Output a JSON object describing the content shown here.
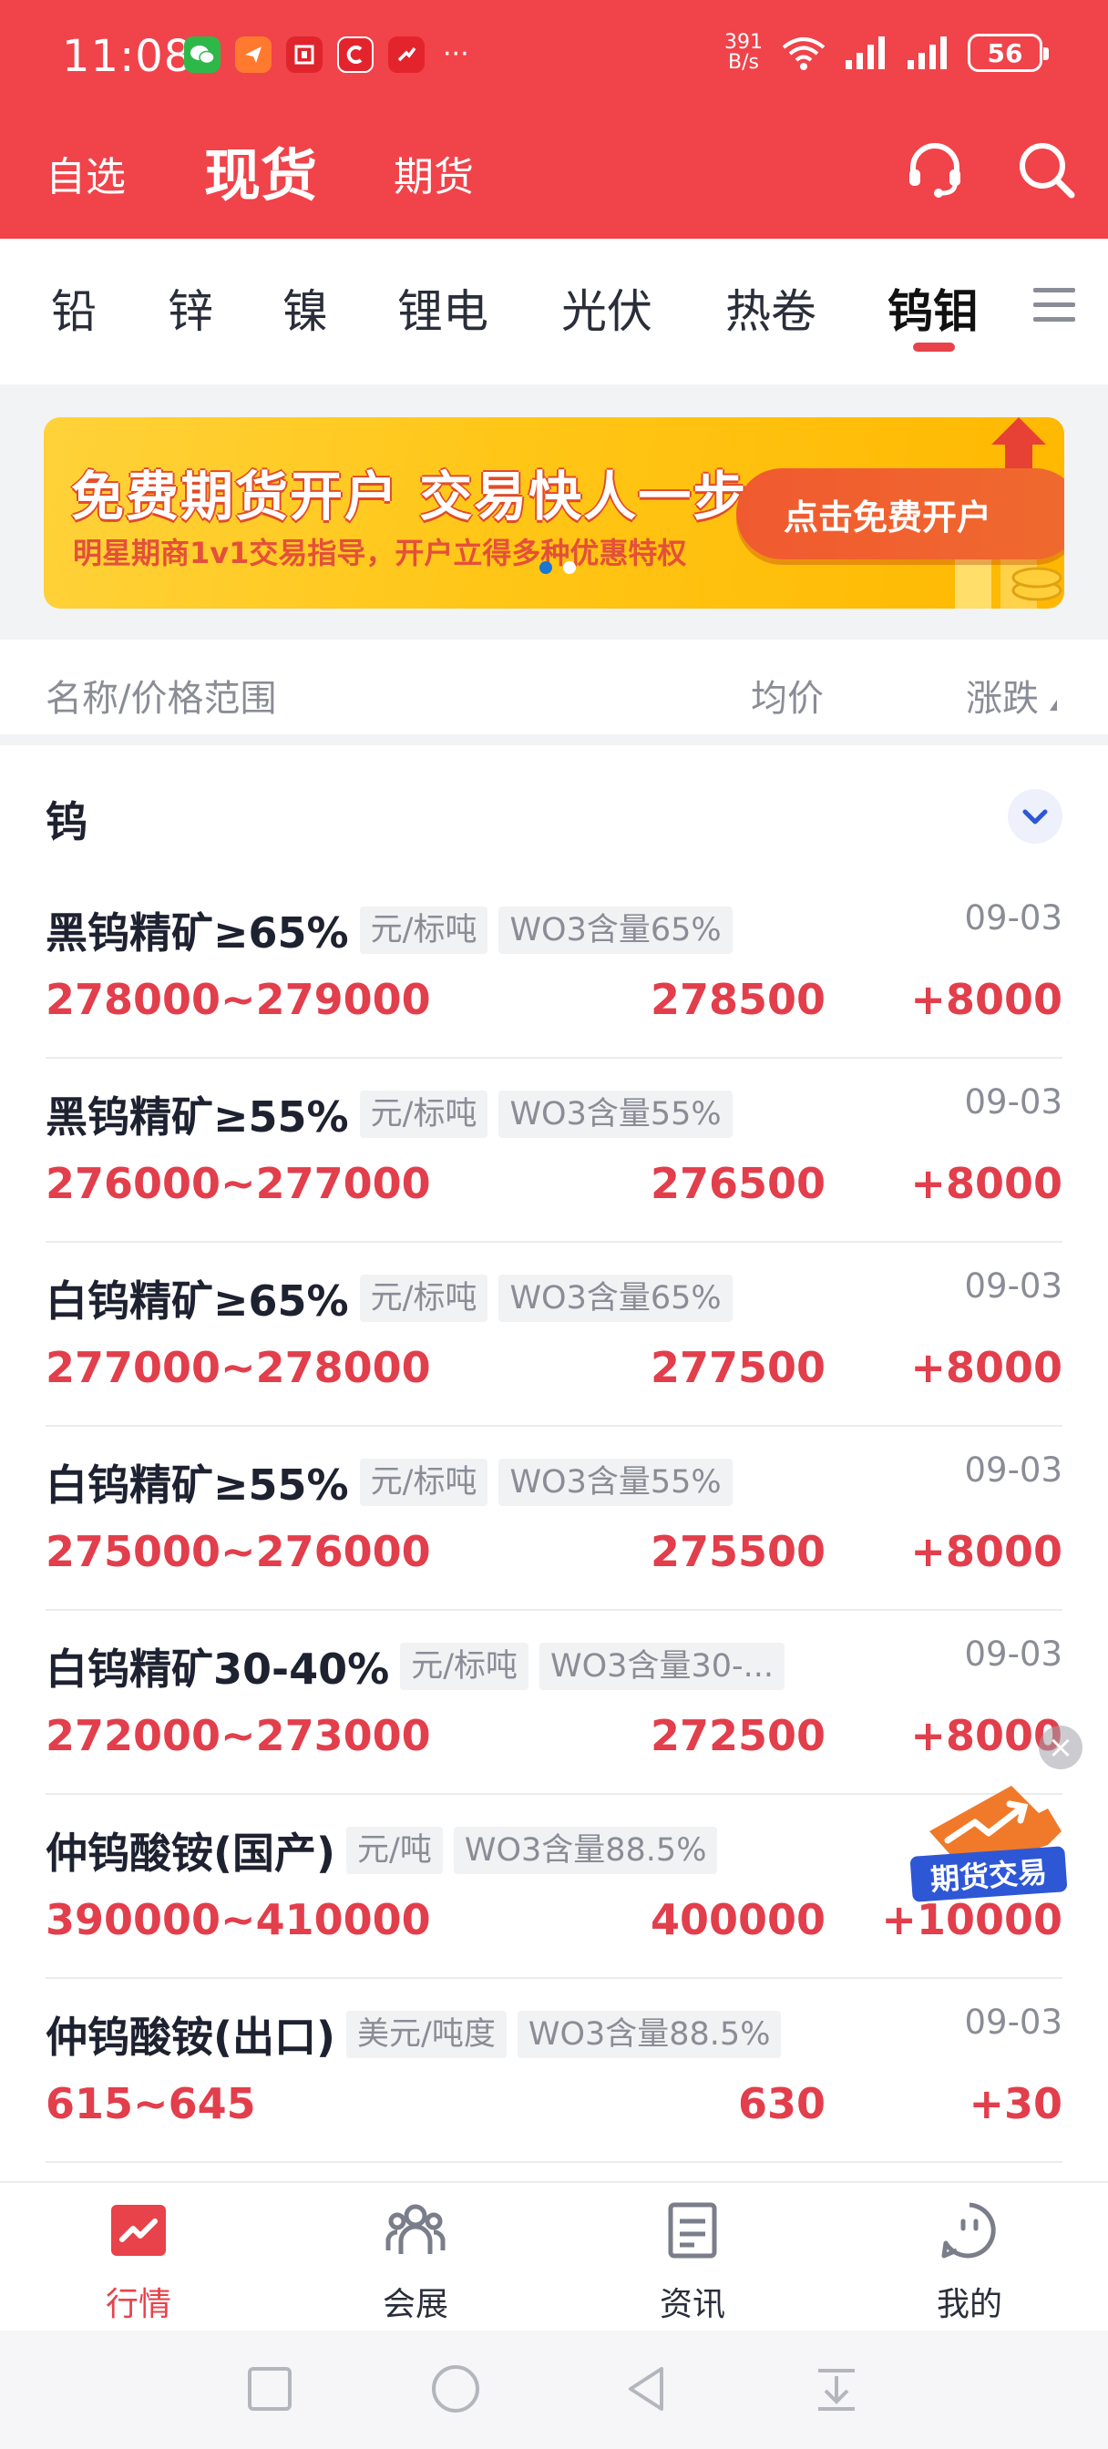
{
  "status_bar": {
    "time": "11:08",
    "net_speed": "391 B/s",
    "net_speed_value": "391",
    "net_speed_unit": "B/s",
    "battery": "56",
    "more": "···"
  },
  "header": {
    "tabs": [
      "自选",
      "现货",
      "期货"
    ],
    "active_tab": "现货",
    "support_icon": "headset-icon",
    "search_icon": "search-icon"
  },
  "categories": {
    "items": [
      "铅",
      "锌",
      "镍",
      "锂电",
      "光伏",
      "热卷",
      "钨钼"
    ],
    "active": "钨钼"
  },
  "banner": {
    "title": "免费期货开户  交易快人一步",
    "subtitle": "明星期商1v1交易指导，开户立得多种优惠特权",
    "cta": "点击免费开户"
  },
  "columns": {
    "name": "名称/价格范围",
    "avg": "均价",
    "change": "涨跌"
  },
  "section": {
    "title": "钨"
  },
  "rows": [
    {
      "name": "黑钨精矿≥65%",
      "unit": "元/标吨",
      "spec": "WO3含量65%",
      "date": "09-03",
      "range": "278000~279000",
      "avg": "278500",
      "change": "+8000"
    },
    {
      "name": "黑钨精矿≥55%",
      "unit": "元/标吨",
      "spec": "WO3含量55%",
      "date": "09-03",
      "range": "276000~277000",
      "avg": "276500",
      "change": "+8000"
    },
    {
      "name": "白钨精矿≥65%",
      "unit": "元/标吨",
      "spec": "WO3含量65%",
      "date": "09-03",
      "range": "277000~278000",
      "avg": "277500",
      "change": "+8000"
    },
    {
      "name": "白钨精矿≥55%",
      "unit": "元/标吨",
      "spec": "WO3含量55%",
      "date": "09-03",
      "range": "275000~276000",
      "avg": "275500",
      "change": "+8000"
    },
    {
      "name": "白钨精矿30-40%",
      "unit": "元/标吨",
      "spec": "WO3含量30-...",
      "date": "09-03",
      "range": "272000~273000",
      "avg": "272500",
      "change": "+8000"
    },
    {
      "name": "仲钨酸铵(国产)",
      "unit": "元/吨",
      "spec": "WO3含量88.5%",
      "date": "",
      "range": "390000~410000",
      "avg": "400000",
      "change": "+10000"
    },
    {
      "name": "仲钨酸铵(出口)",
      "unit": "美元/吨度",
      "spec": "WO3含量88.5%",
      "date": "09-03",
      "range": "615~645",
      "avg": "630",
      "change": "+30"
    }
  ],
  "float_badge": {
    "label": "期货交易",
    "close": "×"
  },
  "tabbar": {
    "items": [
      {
        "label": "行情",
        "icon": "market-chart-icon"
      },
      {
        "label": "会展",
        "icon": "people-icon"
      },
      {
        "label": "资讯",
        "icon": "news-icon"
      },
      {
        "label": "我的",
        "icon": "profile-icon"
      }
    ],
    "active": "行情"
  },
  "colors": {
    "brand_red": "#f0434a",
    "price_red": "#e23e4b",
    "banner_yellow": "#ffc617",
    "accent_blue": "#2e57d6"
  }
}
